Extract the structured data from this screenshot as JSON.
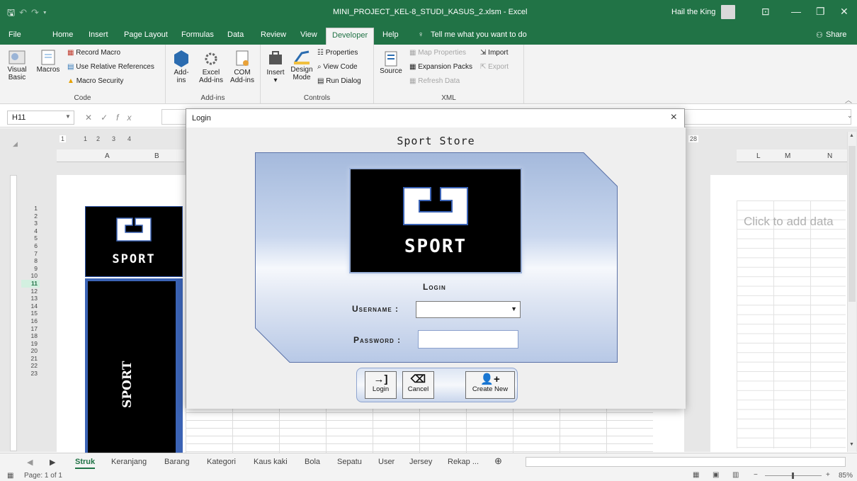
{
  "titlebar": {
    "qat_icons": [
      "save-icon",
      "undo-icon",
      "redo-icon",
      "customize-icon"
    ],
    "document": "MINI_PROJECT_KEL-8_STUDI_KASUS_2.xlsm  -  Excel",
    "user": "Hail the King",
    "window_buttons": [
      "ribbon-display-icon",
      "minimize-icon",
      "restore-icon",
      "close-icon"
    ]
  },
  "tabs": {
    "items": [
      "File",
      "Home",
      "Insert",
      "Page Layout",
      "Formulas",
      "Data",
      "Review",
      "View",
      "Developer",
      "Help"
    ],
    "active": "Developer",
    "tell_me": "Tell me what you want to do",
    "share": "Share"
  },
  "ribbon": {
    "code": {
      "label": "Code",
      "visual_basic": "Visual Basic",
      "macros": "Macros",
      "record_macro": "Record Macro",
      "use_relative": "Use Relative References",
      "macro_security": "Macro Security"
    },
    "addins": {
      "label": "Add-ins",
      "add_ins": "Add-ins",
      "excel_add_ins": "Excel Add-ins",
      "com_add_ins": "COM Add-ins"
    },
    "controls": {
      "label": "Controls",
      "insert": "Insert",
      "design_mode": "Design Mode",
      "properties": "Properties",
      "view_code": "View Code",
      "run_dialog": "Run Dialog"
    },
    "xml": {
      "label": "XML",
      "source": "Source",
      "map_properties": "Map Properties",
      "expansion_packs": "Expansion Packs",
      "refresh_data": "Refresh Data",
      "import": "Import",
      "export": "Export"
    }
  },
  "formula_bar": {
    "name_box": "H11",
    "fx": "fx"
  },
  "worksheet": {
    "columns_left": [
      "A",
      "B"
    ],
    "columns_right": [
      "L",
      "M",
      "N"
    ],
    "ruler_marks": [
      "1",
      "1",
      "2",
      "3",
      "4"
    ],
    "ruler_right": "28",
    "rows": [
      "1",
      "2",
      "3",
      "4",
      "5",
      "6",
      "7",
      "8",
      "9",
      "10",
      "11",
      "12",
      "13",
      "14",
      "15",
      "16",
      "17",
      "18",
      "19",
      "20",
      "21",
      "22",
      "23"
    ],
    "selected_row": "11",
    "click_to_add": "Click to add data",
    "logo_text": "SPORT",
    "vertical_text": "SPORT"
  },
  "sheet_tabs": {
    "items": [
      "Struk",
      "Keranjang",
      "Barang",
      "Kategori",
      "Kaus kaki",
      "Bola",
      "Sepatu",
      "User",
      "Jersey",
      "Rekap ..."
    ],
    "active": "Struk"
  },
  "statusbar": {
    "page": "Page: 1 of 1",
    "zoom": "85%"
  },
  "dialog": {
    "title": "Login",
    "store_name": "Sport Store",
    "logo_text": "SPORT",
    "heading": "Login",
    "username_label": "Username :",
    "password_label": "Password :",
    "username_value": "",
    "password_value": "",
    "buttons": {
      "login": "Login",
      "cancel": "Cancel",
      "create_new": "Create New"
    }
  }
}
